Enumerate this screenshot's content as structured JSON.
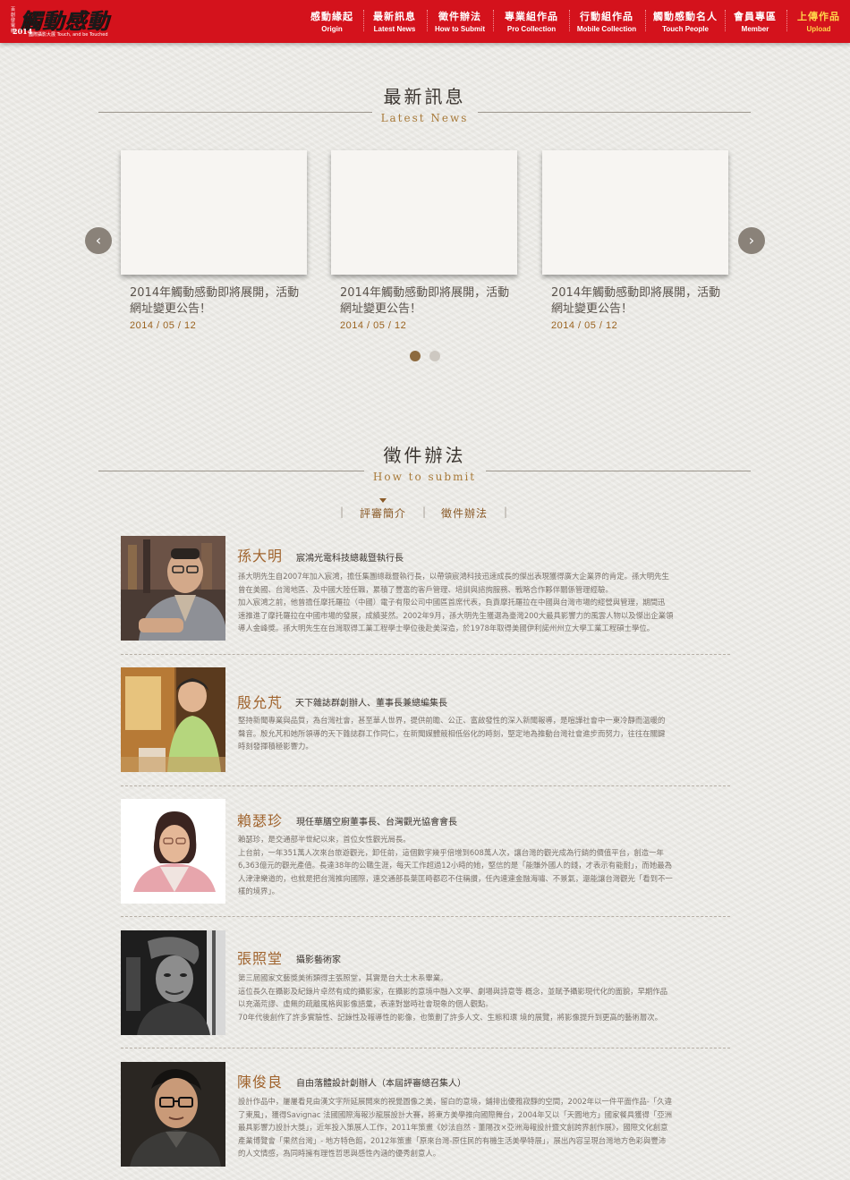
{
  "header": {
    "logo": {
      "title": "觸動感動",
      "year": "2014",
      "side_text": "百創發電機",
      "subtitle": "國際攝影大展 Touch, and be Touched"
    },
    "nav": [
      {
        "zh": "感動緣起",
        "en": "Origin"
      },
      {
        "zh": "最新訊息",
        "en": "Latest News"
      },
      {
        "zh": "徵件辦法",
        "en": "How to Submit"
      },
      {
        "zh": "專業組作品",
        "en": "Pro Collection"
      },
      {
        "zh": "行動組作品",
        "en": "Mobile Collection"
      },
      {
        "zh": "觸動感動名人",
        "en": "Touch People"
      },
      {
        "zh": "會員專區",
        "en": "Member"
      },
      {
        "zh": "上傳作品",
        "en": "Upload"
      }
    ]
  },
  "news": {
    "title_zh": "最新訊息",
    "title_en": "Latest News",
    "prev_icon": "‹",
    "next_icon": "›",
    "items": [
      {
        "title": "2014年觸動感動即將展開，活動網址變更公告！",
        "date": "2014 / 05 / 12"
      },
      {
        "title": "2014年觸動感動即將展開，活動網址變更公告！",
        "date": "2014 / 05 / 12"
      },
      {
        "title": "2014年觸動感動即將展開，活動網址變更公告！",
        "date": "2014 / 05 / 12"
      }
    ],
    "current_page": 1,
    "page_count": 2
  },
  "submit": {
    "title_zh": "徵件辦法",
    "title_en": "How to submit",
    "tabs": [
      {
        "label": "評審簡介",
        "active": true
      },
      {
        "label": "徵件辦法",
        "active": false
      }
    ]
  },
  "judges": [
    {
      "name": "孫大明",
      "title": "宸鴻光電科技總裁暨執行長",
      "bio": "孫大明先生自2007年加入宸鴻，擔任集團總裁暨執行長，以帶領宸鴻科技迅速成長的傑出表現獲得廣大企業界的肯定。孫大明先生\n曾在美國、台灣地區、及中國大陸任職，累積了豐富的客戶管理、培訓與諮詢服務、戰略合作夥伴關係管理經驗。\n加入宸鴻之前，他曾擔任摩托羅拉（中國）電子有限公司中國區首席代表，負責摩托羅拉在中國與台灣市場的經營與管理，期間迅\n速推進了摩托羅拉在中國市場的發展，成績斐然。2002年9月，孫大明先生獲選為臺灣200大最具影響力的風雲人物以及傑出企業領\n導人金峰獎。孫大明先生在台灣取得工業工程學士學位後赴美深造，於1978年取得美國伊利諾州州立大學工業工程碩士學位。"
    },
    {
      "name": "殷允芃",
      "title": "天下雜誌群創辦人、董事長兼總編集長",
      "bio": "堅持新聞專業與品質，為台灣社會，甚至華人世界，提供前瞻、公正、富啟發性的深入新聞報導，是喧譁社會中一東冷靜而溫暖的\n聲音。殷允芃和她所領導的天下雜誌群工作同仁，在新聞媒體競相低俗化的時刻，堅定地為推動台灣社會進步而努力，往往在關鍵\n時刻發揮積極影響力。"
    },
    {
      "name": "賴瑟珍",
      "title": "現任華膳空廚董事長、台灣觀光協會會長",
      "bio": "賴瑟珍，是交通部半世紀以來，首位女性觀光局長。\n上台前，一年351萬人次來台旅遊觀光，卸任前，這個數字幾乎倍增到608萬人次，讓台灣的觀光成為行銷的價值平台，創造一年\n6,363億元的觀光產值。長達38年的公職生涯，每天工作超過12小時的她，堅信的是「能賺外國人的錢，才表示有能耐」，而她最為\n人津津樂道的，也就是把台灣推向國際，連交通部長葉匡時都忍不住稱讚，任內連連金融海嘯、不景氣，還能讓台灣觀光「看到不一\n樣的境界」。"
    },
    {
      "name": "張照堂",
      "title": "攝影藝術家",
      "bio": "第三屆國家文藝獎美術類得主張照堂，其實是台大土木系畢業。\n這位長久在攝影及紀錄片卓然有成的攝影家，在攝影的意境中融入文學、劇場與詩意等 概念，並賦予攝影現代化的面貌，早期作品\n以充滿荒謬、虛無的疏離風格與影像語彙，表達對當時社會現象的個人觀點。\n70年代後創作了許多實驗性、記錄性及報導性的影像，也策劃了許多人文、生態和環 境的展覽，將影像提升到更高的藝術層次。"
    },
    {
      "name": "陳俊良",
      "title": "自由落體設計創辦人（本屆評審總召集人）",
      "bio": "設計作品中，屢屢看見由漢文字所延展開來的視覺圖像之美，留白的意境，鋪排出優雅寂靜的空間，2002年以一件平面作品-「久違\n了東風」，獲得Savignac 法國國際海報沙龍展設計大賽，將東方美學推向國際舞台，2004年又以「天圓地方」國家餐具獲得「亞洲\n最具影響力設計大獎」，近年投入策展人工作，2011年策畫《妙法自然 - 董陽孜×亞洲海報設計暨文創跨界創作展》，國際文化創意\n產業博覽會「果然台灣」- 地方特色館，2012年策畫「原來台灣-原住民的有機生活美學特展」，展出內容呈現台灣地方色彩與豐沛\n的人文情感，為同時擁有理性哲思與感性內涵的優秀創意人。"
    }
  ]
}
